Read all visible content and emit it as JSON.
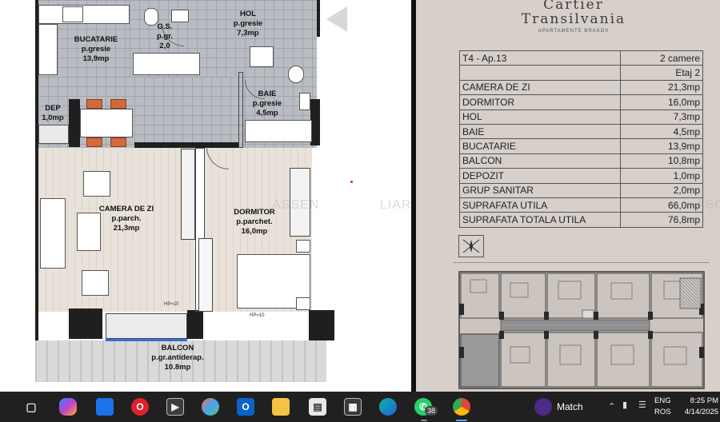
{
  "plan": {
    "rooms": {
      "bucatarie": {
        "name": "BUCATARIE",
        "floor": "p.gresie",
        "area": "13,9mp"
      },
      "gs": {
        "name": "G.S.",
        "floor": "p.gr.",
        "area": "2,0"
      },
      "hol": {
        "name": "HOL",
        "floor": "p.gresie",
        "area": "7,3mp"
      },
      "baie": {
        "name": "BAIE",
        "floor": "p.gresie",
        "area": "4,5mp"
      },
      "dep": {
        "name": "DEP",
        "area": "1,0mp"
      },
      "camera": {
        "name": "CAMERA DE ZI",
        "floor": "p.parch.",
        "area": "21,3mp"
      },
      "dormitor": {
        "name": "DORMITOR",
        "floor": "p.parchet.",
        "area": "16,0mp"
      },
      "balcon": {
        "name": "BALCON",
        "floor": "p.gr.antiderap.",
        "area": "10.8mp"
      }
    },
    "hp_label_1": "HP=10",
    "hp_label_2": "HP=10",
    "watermark_1": "ASSEN",
    "watermark_2": "LIARE",
    "watermark_3": "ASC"
  },
  "panel": {
    "brand_line1": "Cartier",
    "brand_line2": "Transilvania",
    "brand_sub": "APARTAMENTE BRASOV",
    "apartment": {
      "label": "T4 - Ap.13",
      "rooms": "2 camere",
      "floor": "Etaj 2"
    },
    "rows": [
      {
        "label": "CAMERA DE ZI",
        "value": "21,3mp"
      },
      {
        "label": "DORMITOR",
        "value": "16,0mp"
      },
      {
        "label": "HOL",
        "value": "7,3mp"
      },
      {
        "label": "BAIE",
        "value": "4,5mp"
      },
      {
        "label": "BUCATARIE",
        "value": "13,9mp"
      },
      {
        "label": "BALCON",
        "value": "10,8mp"
      },
      {
        "label": "DEPOZIT",
        "value": "1,0mp"
      },
      {
        "label": "GRUP SANITAR",
        "value": "2,0mp"
      },
      {
        "label": "SUPRAFATA UTILA",
        "value": "66,0mp"
      },
      {
        "label": "SUPRAFATA TOTALA UTILA",
        "value": "76,8mp"
      }
    ]
  },
  "taskbar": {
    "messenger_badge": "38",
    "news_text": "Match",
    "lang_line1": "ENG",
    "lang_line2": "ROS",
    "time": "8:25 PM",
    "date": "4/14/2025"
  },
  "colors": {
    "panel_bg": "#d6cfca",
    "tile": "#b9bdc3",
    "parquet": "#e9e2db",
    "chair": "#d2693c",
    "taskbar_bg": "#202020",
    "balcony_rail": "#3a6fd8"
  }
}
